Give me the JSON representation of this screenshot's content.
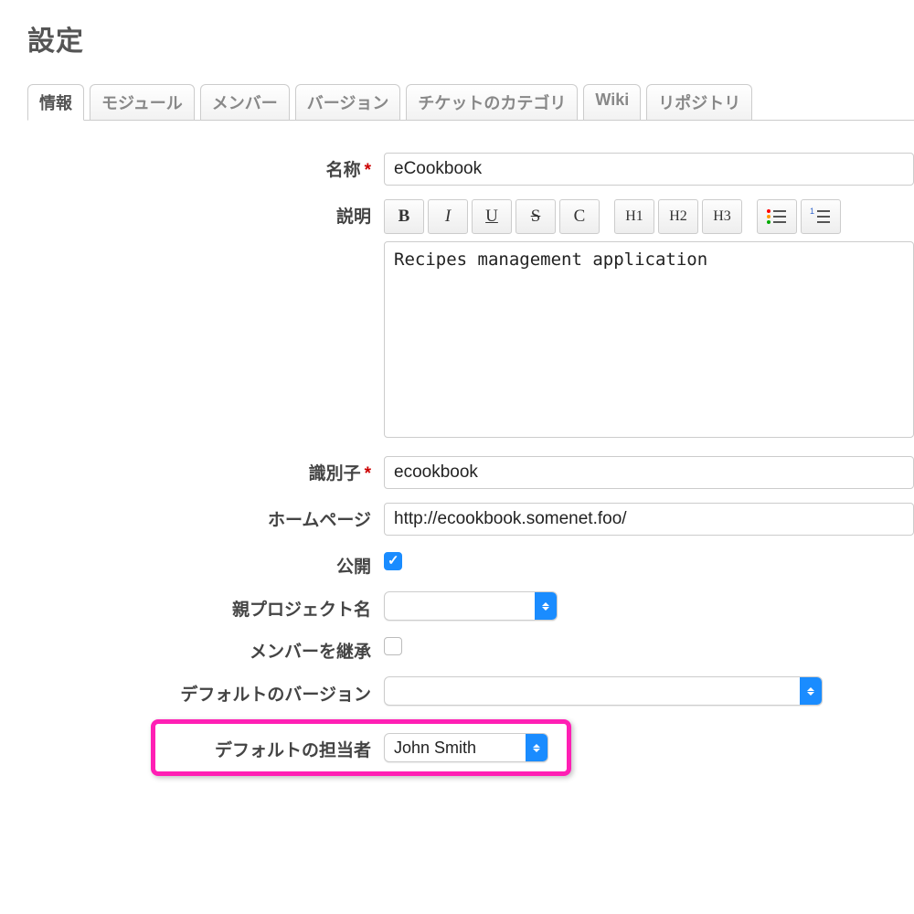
{
  "page_title": "設定",
  "tabs": {
    "info": "情報",
    "modules": "モジュール",
    "members": "メンバー",
    "versions": "バージョン",
    "categories": "チケットのカテゴリ",
    "wiki": "Wiki",
    "repos": "リポジトリ"
  },
  "labels": {
    "name": "名称",
    "description": "説明",
    "identifier": "識別子",
    "homepage": "ホームページ",
    "public": "公開",
    "parent": "親プロジェクト名",
    "inherit": "メンバーを継承",
    "default_version": "デフォルトのバージョン",
    "default_assignee": "デフォルトの担当者"
  },
  "values": {
    "name": "eCookbook",
    "description": "Recipes management application",
    "identifier": "ecookbook",
    "homepage": "http://ecookbook.somenet.foo/",
    "default_assignee": "John Smith"
  },
  "toolbar": {
    "bold": "B",
    "italic": "I",
    "underline": "U",
    "strike": "S",
    "code": "C",
    "h1": "H1",
    "h2": "H2",
    "h3": "H3"
  }
}
